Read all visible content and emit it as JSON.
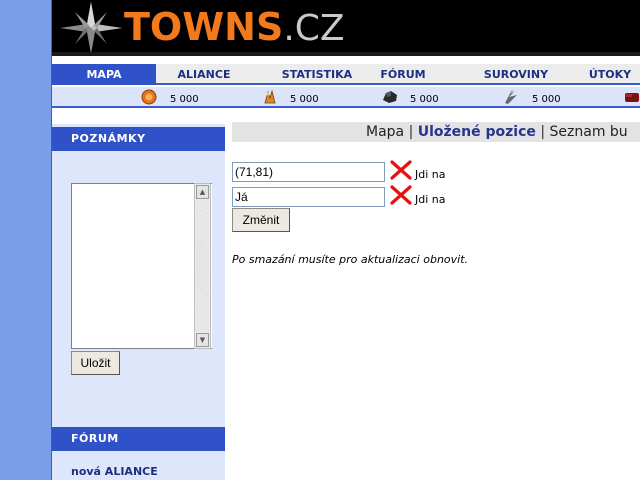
{
  "header": {
    "logo_main": "TOWNS",
    "logo_suffix": ".CZ"
  },
  "nav": {
    "items": [
      {
        "label": "MAPA",
        "active": true
      },
      {
        "label": "ALIANCE",
        "active": false
      },
      {
        "label": "STATISTIKA",
        "active": false
      },
      {
        "label": "FÓRUM",
        "active": false
      },
      {
        "label": "SUROVINY",
        "active": false
      },
      {
        "label": "ÚTOKY",
        "active": false
      }
    ]
  },
  "resources": [
    {
      "icon": "gold-coin-icon",
      "value": "5 000"
    },
    {
      "icon": "food-icon",
      "value": "5 000"
    },
    {
      "icon": "stone-icon",
      "value": "5 000"
    },
    {
      "icon": "iron-icon",
      "value": "5 000"
    },
    {
      "icon": "wood-icon",
      "value": ""
    }
  ],
  "sidebar": {
    "notes_title": "POZNÁMKY",
    "notes_text": "",
    "save_label": "Uložit",
    "forum_title": "FÓRUM",
    "forum_link": "nová ALIANCE"
  },
  "content": {
    "tabs": {
      "map": "Mapa",
      "separator": "|",
      "saved": "Uložené pozice",
      "list": "Seznam bu"
    },
    "positions": [
      {
        "value": "(71,81)",
        "go_label": "Jdi na"
      },
      {
        "value": "Já",
        "go_label": "Jdi na"
      }
    ],
    "change_label": "Změnit",
    "note": "Po smazání musíte pro aktualizaci obnovit."
  },
  "colors": {
    "accent": "#2f52c9",
    "page_background": "#7b9eea",
    "logo_orange": "#f27a1c",
    "delete_red": "#e81010"
  }
}
